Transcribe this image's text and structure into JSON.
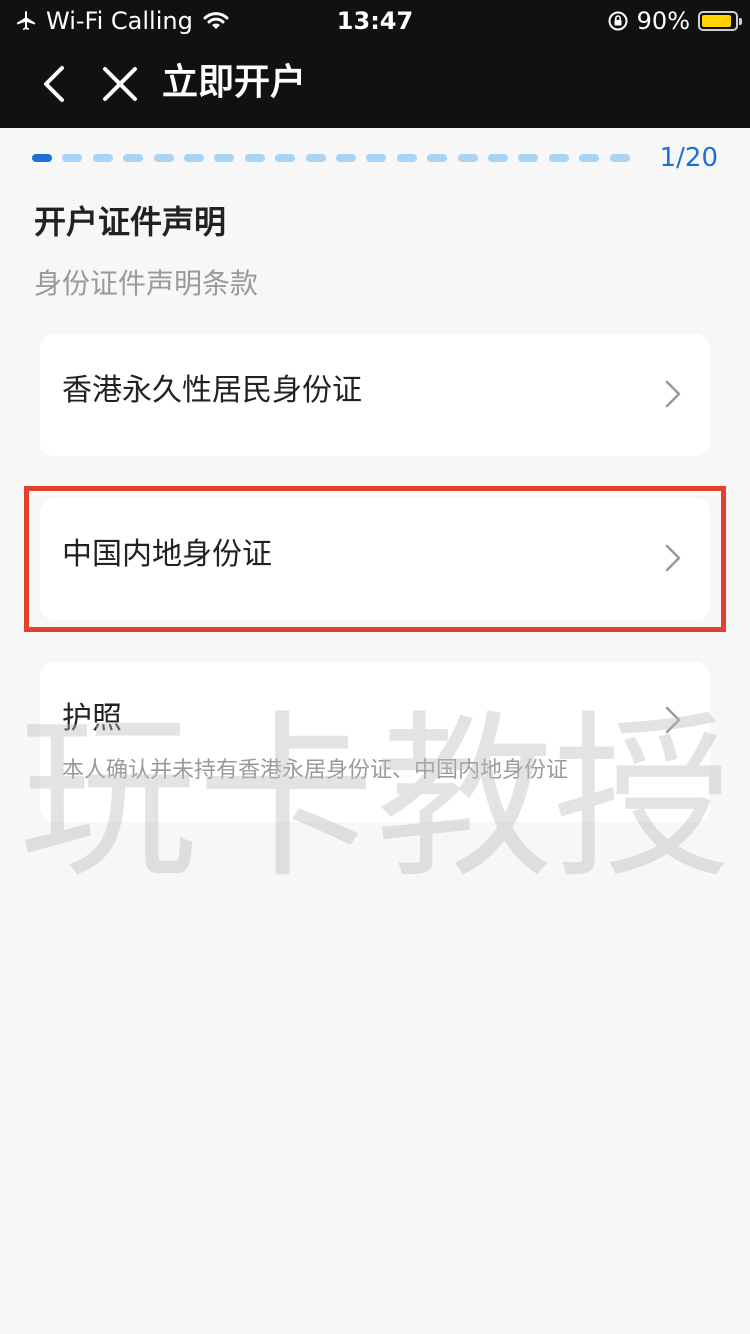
{
  "status_bar": {
    "carrier": "Wi-Fi Calling",
    "time": "13:47",
    "battery_percent": "90%",
    "battery_level": 0.9,
    "battery_color": "#ffd400",
    "icons": [
      "airplane-icon",
      "wifi-icon",
      "orientation-lock-icon",
      "battery-icon"
    ]
  },
  "nav": {
    "title": "立即开户",
    "back_icon": "chevron-left-icon",
    "close_icon": "close-icon"
  },
  "progress": {
    "current": 1,
    "total": 20,
    "label": "1/20",
    "active_color": "#1e6fd9",
    "inactive_color": "#a8d4f5"
  },
  "section": {
    "title": "开户证件声明",
    "subtitle": "身份证件声明条款"
  },
  "options": [
    {
      "label": "香港永久性居民身份证",
      "highlighted": false
    },
    {
      "label": "中国内地身份证",
      "highlighted": true
    },
    {
      "label": "护照",
      "note": "本人确认并未持有香港永居身份证、中国内地身份证",
      "highlighted": false
    }
  ],
  "highlight_color": "#e2412e",
  "watermark": "玩卡教授"
}
